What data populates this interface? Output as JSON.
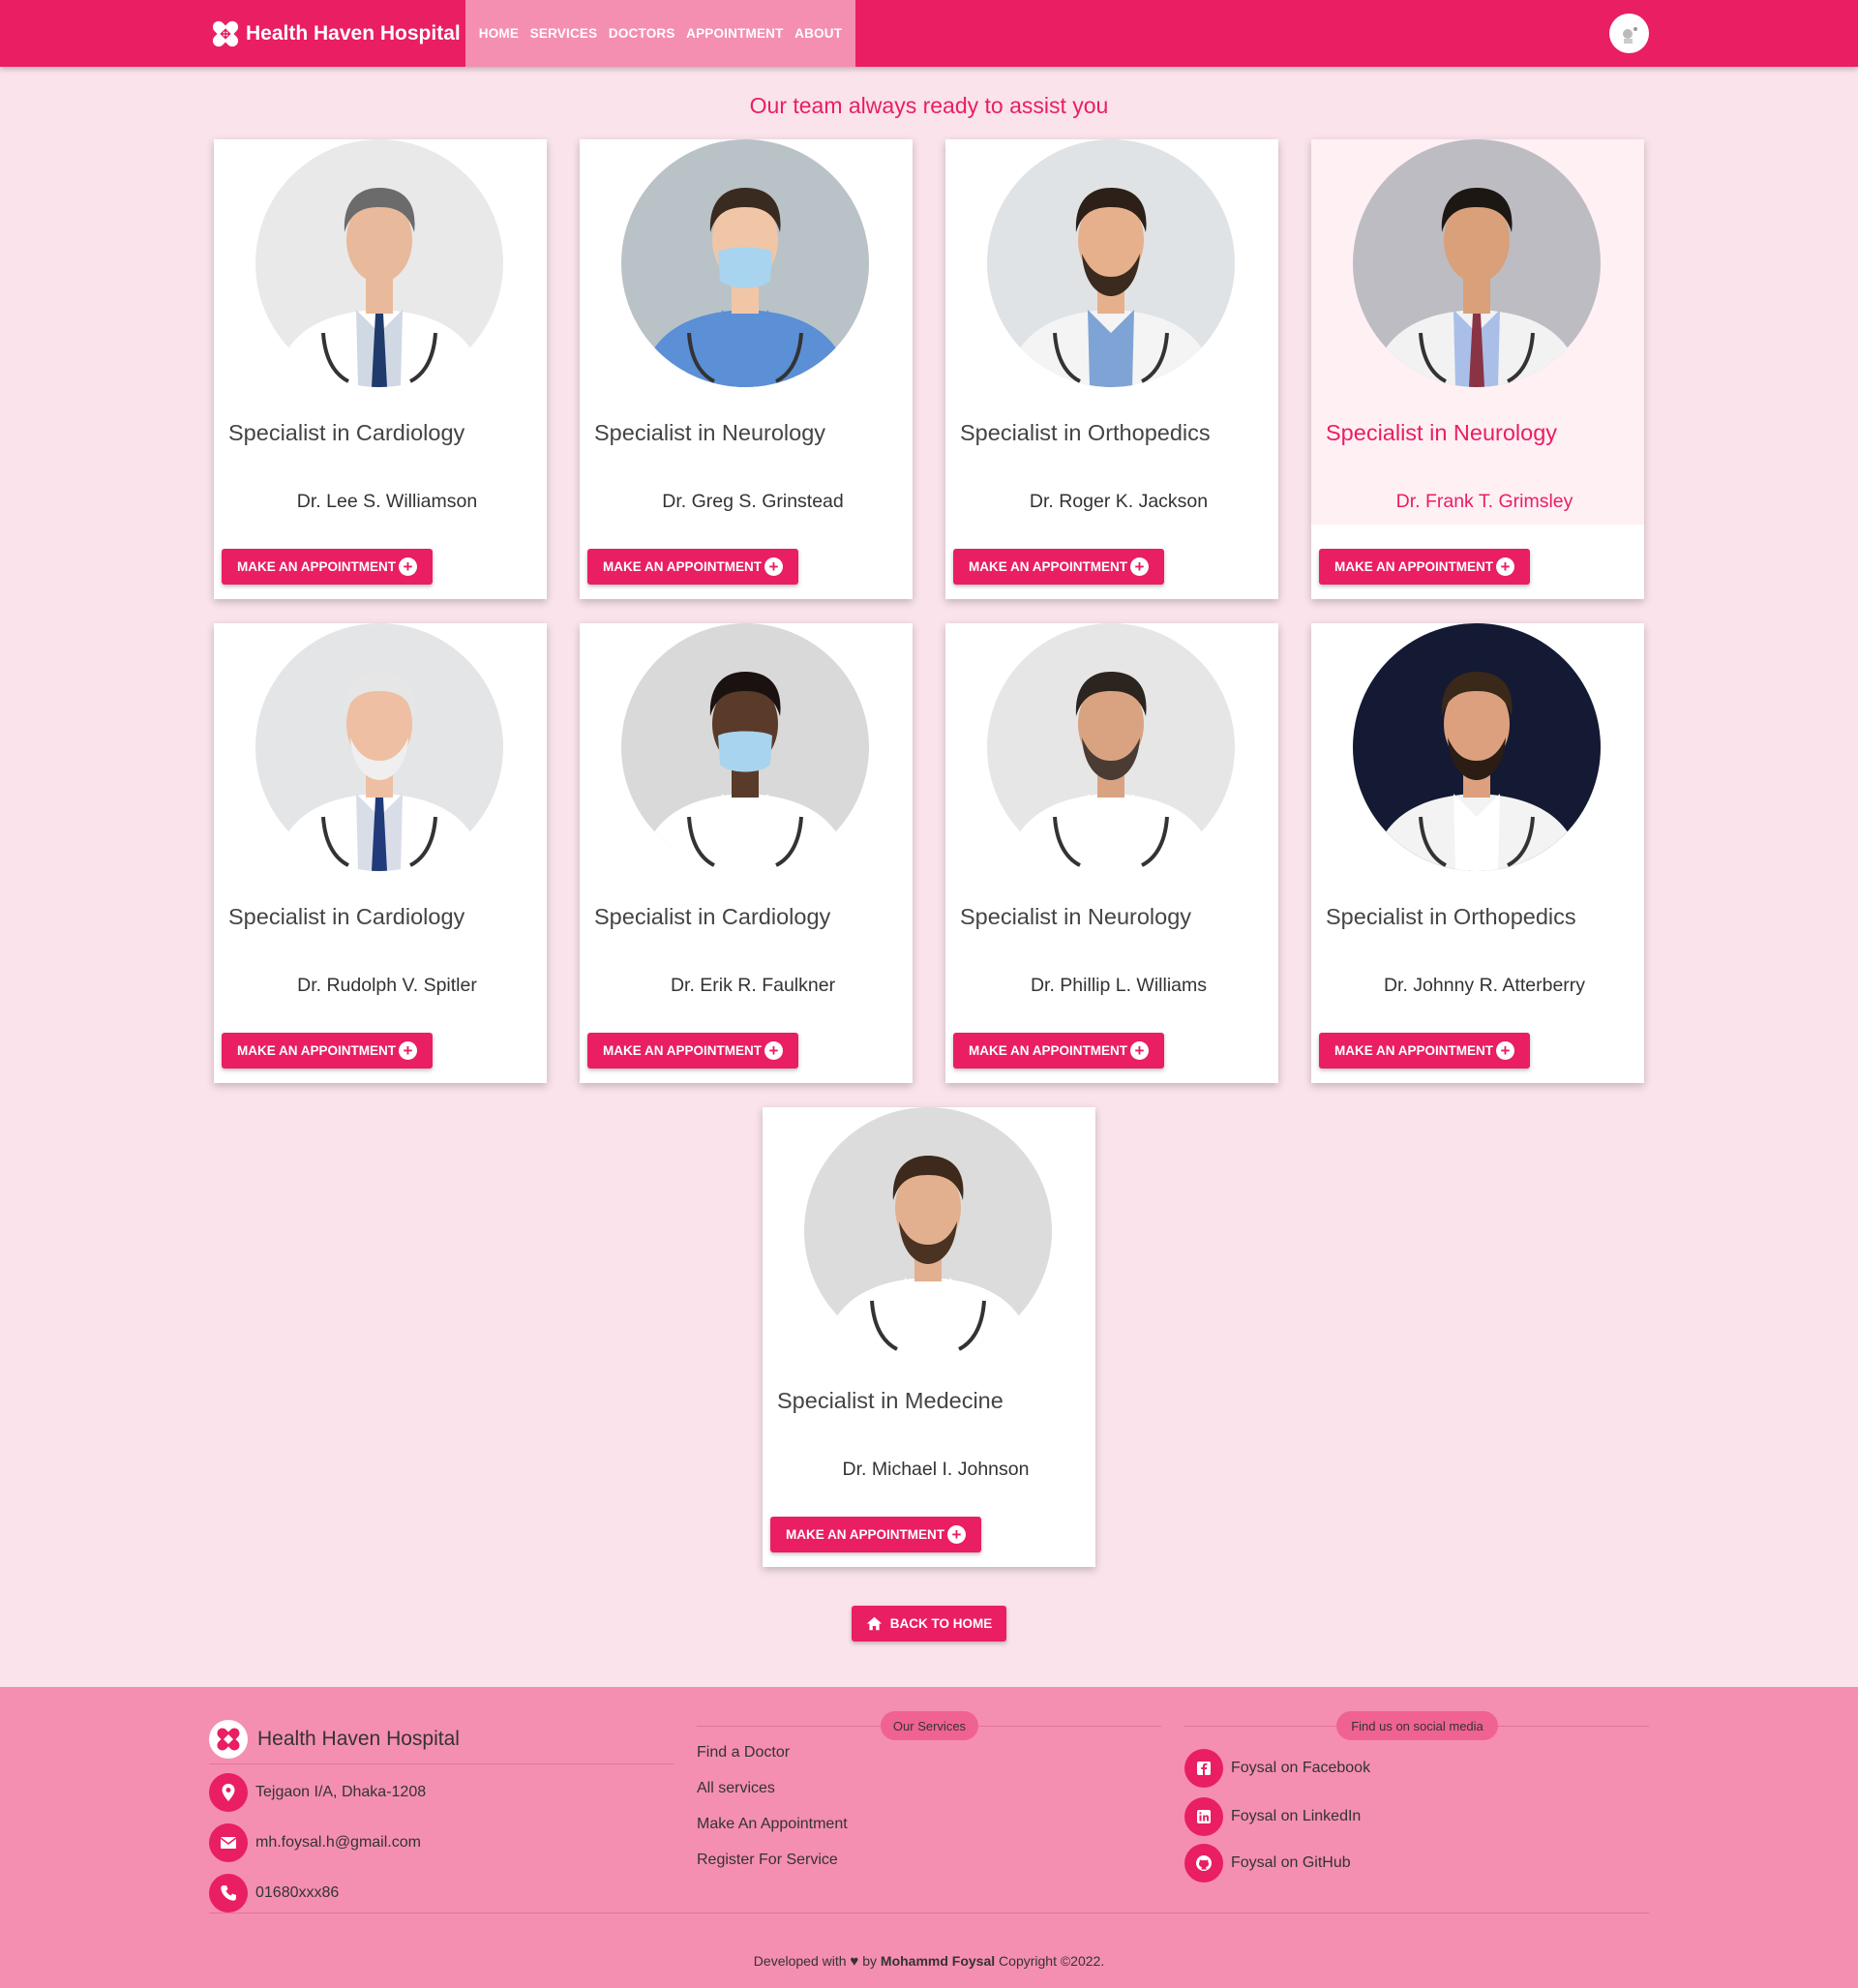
{
  "brand": {
    "name": "Health Haven Hospital"
  },
  "nav": {
    "items": [
      "HOME",
      "SERVICES",
      "DOCTORS",
      "APPOINTMENT",
      "ABOUT"
    ]
  },
  "page": {
    "title": "Our team always ready to assist you"
  },
  "appointment_label": "MAKE AN APPOINTMENT",
  "doctors": [
    {
      "specialty": "Specialist in Cardiology",
      "name": "Dr. Lee S. Williamson",
      "portrait": "doctor-photo-gray-hair-tie"
    },
    {
      "specialty": "Specialist in Neurology",
      "name": "Dr. Greg S. Grinstead",
      "portrait": "doctor-photo-female-mask"
    },
    {
      "specialty": "Specialist in Orthopedics",
      "name": "Dr. Roger K. Jackson",
      "portrait": "doctor-photo-beard-glasses"
    },
    {
      "specialty": "Specialist in Neurology",
      "name": "Dr. Frank T. Grimsley",
      "portrait": "doctor-photo-glasses-tie"
    },
    {
      "specialty": "Specialist in Cardiology",
      "name": "Dr. Rudolph V. Spitler",
      "portrait": "doctor-photo-white-hair-beard"
    },
    {
      "specialty": "Specialist in Cardiology",
      "name": "Dr. Erik R. Faulkner",
      "portrait": "doctor-photo-mask"
    },
    {
      "specialty": "Specialist in Neurology",
      "name": "Dr. Phillip L. Williams",
      "portrait": "doctor-photo-glasses-beard"
    },
    {
      "specialty": "Specialist in Orthopedics",
      "name": "Dr. Johnny R. Atterberry",
      "portrait": "doctor-photo-dark-background"
    },
    {
      "specialty": "Specialist in Medecine",
      "name": "Dr. Michael I. Johnson",
      "portrait": "doctor-photo-young-beard"
    }
  ],
  "back_button": {
    "label": "BACK TO HOME"
  },
  "footer": {
    "brand": "Health Haven Hospital",
    "address": "Tejgaon I/A, Dhaka-1208",
    "email": "mh.foysal.h@gmail.com",
    "phone": "01680xxx86",
    "services_title": "Our Services",
    "services": [
      "Find a Doctor",
      "All services",
      "Make An Appointment",
      "Register For Service"
    ],
    "social_title": "Find us on social media",
    "social": [
      {
        "label": "Foysal on Facebook",
        "icon": "facebook-icon"
      },
      {
        "label": "Foysal on LinkedIn",
        "icon": "linkedin-icon"
      },
      {
        "label": "Foysal on GitHub",
        "icon": "github-icon"
      }
    ],
    "copyright": {
      "prefix": "Developed with",
      "by": "by",
      "author": "Mohammd Foysal",
      "suffix": "Copyright ©2022."
    }
  },
  "colors": {
    "primary": "#e91e63",
    "nav_active": "#f48fb1",
    "page_bg": "#fae3eb",
    "footer_bg": "#f48fb1"
  }
}
